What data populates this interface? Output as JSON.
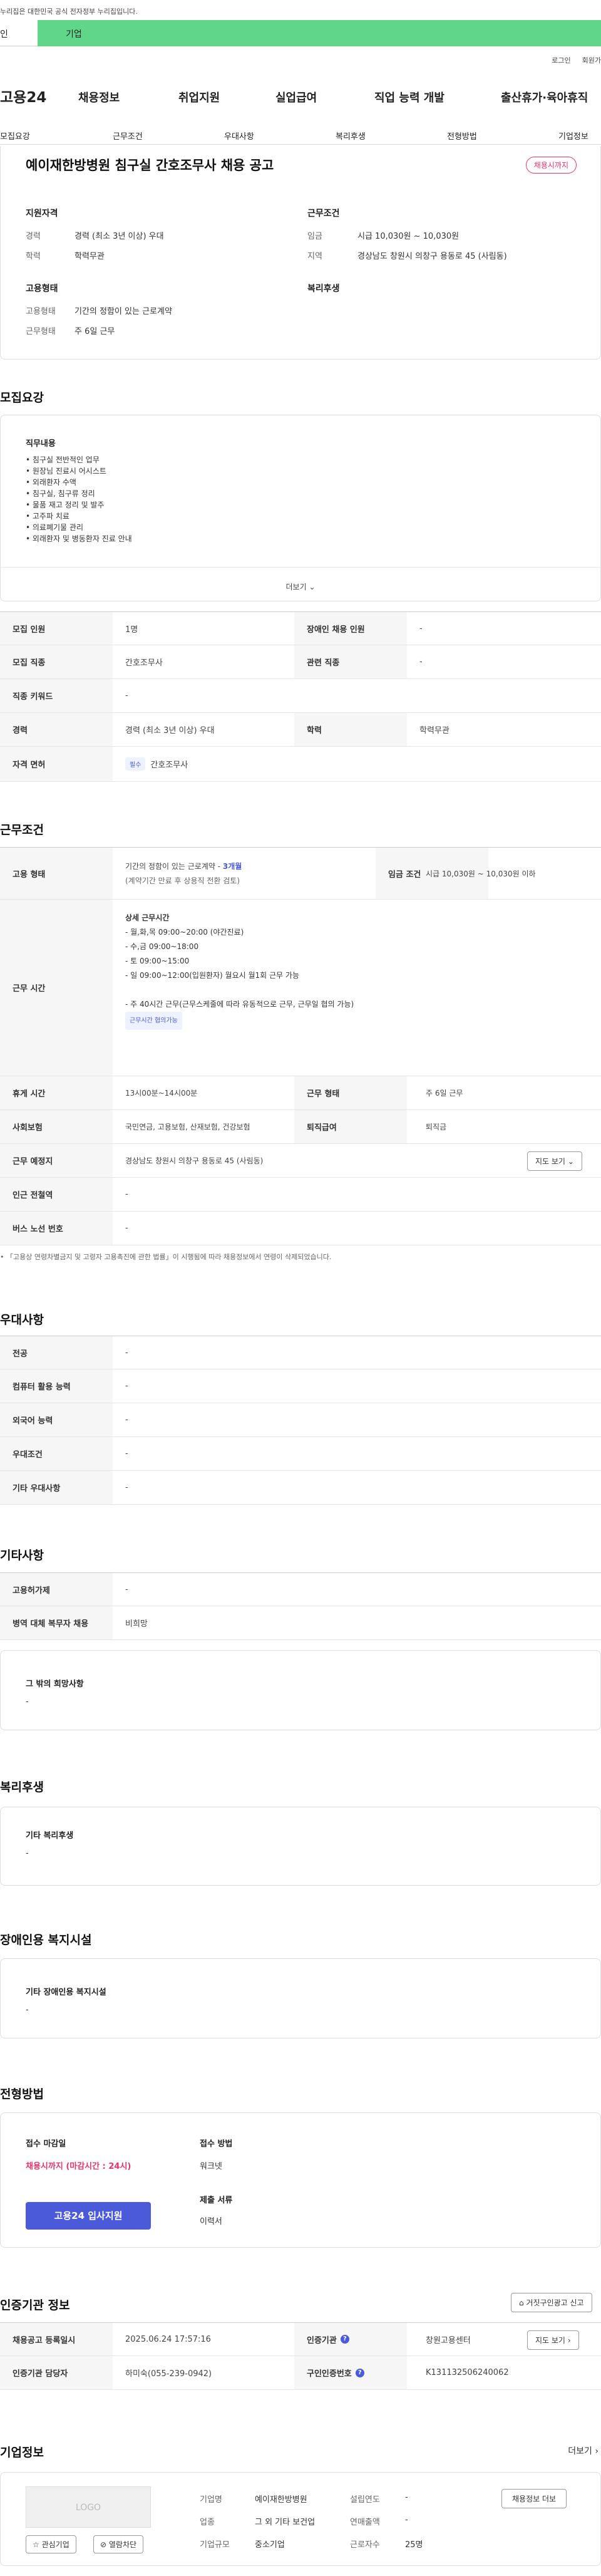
{
  "gov_notice": "누리집은 대한민국 공식 전자정부 누리집입니다.",
  "top_tabs": {
    "person": "인",
    "business": "기업"
  },
  "util_links": [
    "로그인",
    "회원가"
  ],
  "logo": "고용24",
  "gnb": [
    "채용정보",
    "취업지원",
    "실업급여",
    "직업 능력 개발",
    "출산휴가·육아휴직"
  ],
  "subnav": [
    "모집요강",
    "근무조건",
    "우대사항",
    "복리후생",
    "전형방법",
    "기업정보"
  ],
  "summary": {
    "title": "예이재한방병원 침구실 간호조무사 채용 공고",
    "status_badge": "채용시까지",
    "qual_label": "지원자격",
    "career_key": "경력",
    "career_val": "경력 (최소 3년 이상) 우대",
    "edu_key": "학력",
    "edu_val": "학력무관",
    "cond_label": "근무조건",
    "wage_key": "임금",
    "wage_val": "시급 10,030원 ~ 10,030원",
    "region_key": "지역",
    "region_val": "경상남도 창원시 의창구 용동로 45 (사림동)",
    "emp_label": "고용형태",
    "emp_key": "고용형태",
    "emp_val": "기간의 정함이 있는 근로계약",
    "days_key": "근무형태",
    "days_val": "주 6일 근무",
    "welfare_label": "복리후생"
  },
  "recruit": {
    "heading": "모집요강",
    "duty_label": "직무내용",
    "duties": [
      "• 침구실 전반적인 업무",
      "• 원장님 진료시 어시스트",
      "• 외래환자 수액",
      "• 침구실, 침구류 정리",
      "• 물품 재고 정리 및 발주",
      "• 고주파 치료",
      "• 의료폐기물 관리",
      "• 외래환자 및 병동환자 진료 안내"
    ],
    "more_label": "더보기",
    "rows": [
      {
        "k1": "모집 인원",
        "v1": "1명",
        "k2": "장애인 채용 인원",
        "v2": "-"
      },
      {
        "k1": "모집 직종",
        "v1": "간호조무사",
        "k2": "관련 직종",
        "v2": "-"
      },
      {
        "k1": "직종 키워드",
        "v1": "-",
        "k2": "",
        "v2": ""
      },
      {
        "k1": "경력",
        "v1": "경력 (최소 3년 이상) 우대",
        "k2": "학력",
        "v2": "학력무관"
      }
    ],
    "license_key": "자격 면허",
    "license_tag": "필수",
    "license_val": "간호조무사"
  },
  "work": {
    "heading": "근무조건",
    "emp_key": "고용 형태",
    "emp_val": "기간의 정함이 있는 근로계약 -",
    "emp_months": "3개월",
    "emp_note": "(계약기간 만료 후 상용직 전환 검토)",
    "wage_key": "임금 조건",
    "wage_val": "시급 10,030원 ~ 10,030원 이하",
    "time_key": "근무 시간",
    "time_title": "상세 근무시간",
    "time_lines": [
      "- 월,화,목 09:00~20:00 (야간진료)",
      "- 수,금 09:00~18:00",
      "- 토 09:00~15:00",
      "- 일 09:00~12:00(입원환자) 월요시 월1회 근무 가능",
      "",
      "- 주 40시간 근무(근무스케줄에 따라 유동적으로 근무, 근무일 협의 가능)"
    ],
    "time_tag": "근무시간 협의가능",
    "rest_key": "휴게 시간",
    "rest_val": "13시00분~14시00분",
    "form_key": "근무 형태",
    "form_val": "주 6일 근무",
    "ins_key": "사회보험",
    "ins_val": "국민연금, 고용보험, 산재보험, 건강보험",
    "retire_key": "퇴직급여",
    "retire_val": "퇴직금",
    "place_key": "근무 예정지",
    "place_val": "경상남도 창원시 의창구 용동로 45 (사림동)",
    "map_btn": "지도 보기",
    "subway_key": "인근 전철역",
    "subway_val": "-",
    "bus_key": "버스 노선 번호",
    "bus_val": "-",
    "note": "• 「고용상 연령차별금지 및 고령자 고용촉진에 관한 법률」이 시행됨에 따라 채용정보에서 연령이 삭제되었습니다."
  },
  "pref": {
    "heading": "우대사항",
    "rows": [
      [
        "전공",
        "-"
      ],
      [
        "컴퓨터 활용 능력",
        "-"
      ],
      [
        "외국어 능력",
        "-"
      ],
      [
        "우대조건",
        "-"
      ],
      [
        "기타 우대사항",
        "-"
      ]
    ]
  },
  "etc": {
    "heading": "기타사항",
    "rows": [
      [
        "고용허가제",
        "-"
      ],
      [
        "병역 대체 복무자 채용",
        "비희망"
      ]
    ],
    "wish_label": "그 밖의 희망사항",
    "wish_val": "-"
  },
  "welfare": {
    "heading": "복리후생",
    "label": "기타 복리후생",
    "val": "-"
  },
  "disabled": {
    "heading": "장애인용 복지시설",
    "label": "기타 장애인용 복지시설",
    "val": "-"
  },
  "selection": {
    "heading": "전형방법",
    "deadline_label": "접수 마감일",
    "deadline_val": "채용시까지 (마감시간 : 24시)",
    "method_label": "접수 방법",
    "method_val": "워크넷",
    "docs_label": "제출 서류",
    "docs_val": "이력서",
    "apply_btn": "고용24 입사지원"
  },
  "cert": {
    "heading": "인증기관 정보",
    "report_btn": "거짓구인광고 신고",
    "reg_key": "채용공고 등록일시",
    "reg_val": "2025.06.24 17:57:16",
    "org_key": "인증기관",
    "org_val": "창원고용센터",
    "map_btn": "지도 보기",
    "mgr_key": "인증기관 담당자",
    "mgr_val": "하미숙(055-239-0942)",
    "no_key": "구인인증번호",
    "no_val": "K131132506240062"
  },
  "company": {
    "heading": "기업정보",
    "more": "더보기",
    "logo_text": "LOGO",
    "fav_btn": "관심기업",
    "block_btn": "열람차단",
    "name_key": "기업명",
    "name_val": "예이재한방병원",
    "found_key": "설립연도",
    "found_val": "-",
    "biz_key": "업종",
    "biz_val": "그 외 기타 보건업",
    "sales_key": "연매출액",
    "sales_val": "-",
    "size_key": "기업규모",
    "size_val": "중소기업",
    "emp_key": "근로자수",
    "emp_val": "25명",
    "jobs_btn": "채용정보 더보"
  }
}
